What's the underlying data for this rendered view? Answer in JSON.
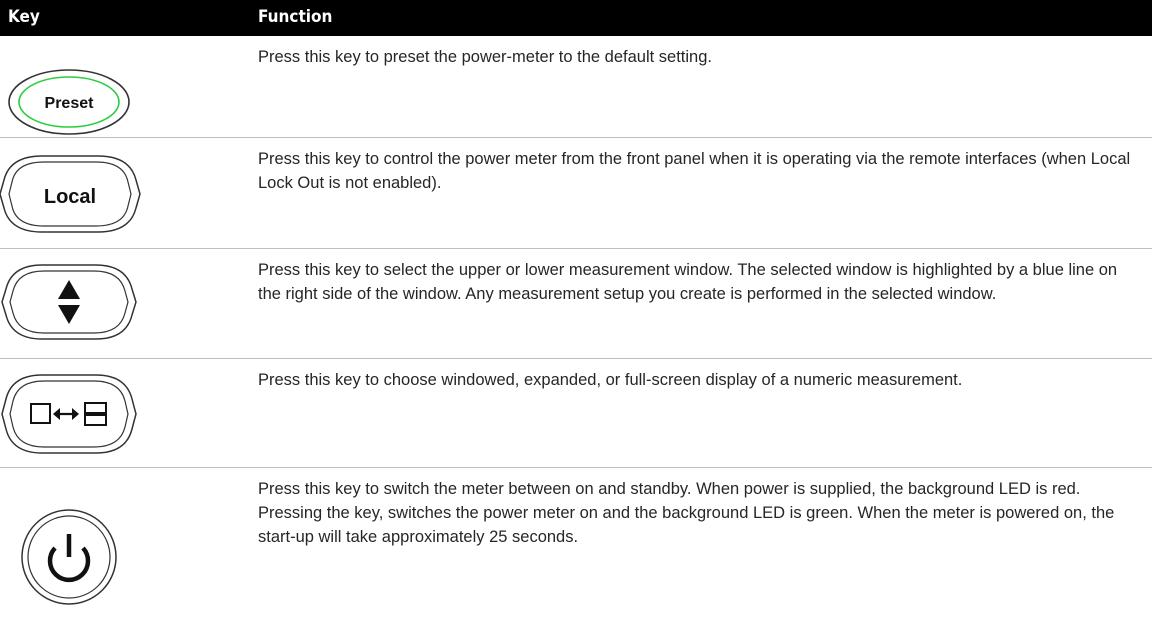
{
  "header": {
    "key_label": "Key",
    "function_label": "Function"
  },
  "rows": [
    {
      "key_name": "preset-key",
      "key_text": "Preset",
      "description": "Press this key to preset the power-meter to the default setting."
    },
    {
      "key_name": "local-key",
      "key_text": "Local",
      "description": "Press this key to control the power meter from the front panel when it is operating via the remote interfaces (when Local Lock Out is not enabled)."
    },
    {
      "key_name": "window-select-key",
      "key_text": "",
      "description": "Press this key to select the upper or lower measurement window. The selected window is highlighted by a blue line on the right side of the window. Any measurement setup you create is performed in the selected window."
    },
    {
      "key_name": "display-mode-key",
      "key_text": "",
      "description": "Press this key to choose windowed, expanded, or full-screen display of a numeric measurement."
    },
    {
      "key_name": "power-key",
      "key_text": "",
      "description": "Press this key to switch the meter between on and standby. When power is supplied, the background LED is red. Pressing the key, switches the power meter on and the background LED is green. When the meter is powered on, the start-up will take approximately 25 seconds."
    }
  ],
  "colors": {
    "header_bg": "#000000",
    "preset_ring": "#2ecc40",
    "separator": "#bdbdbd"
  }
}
